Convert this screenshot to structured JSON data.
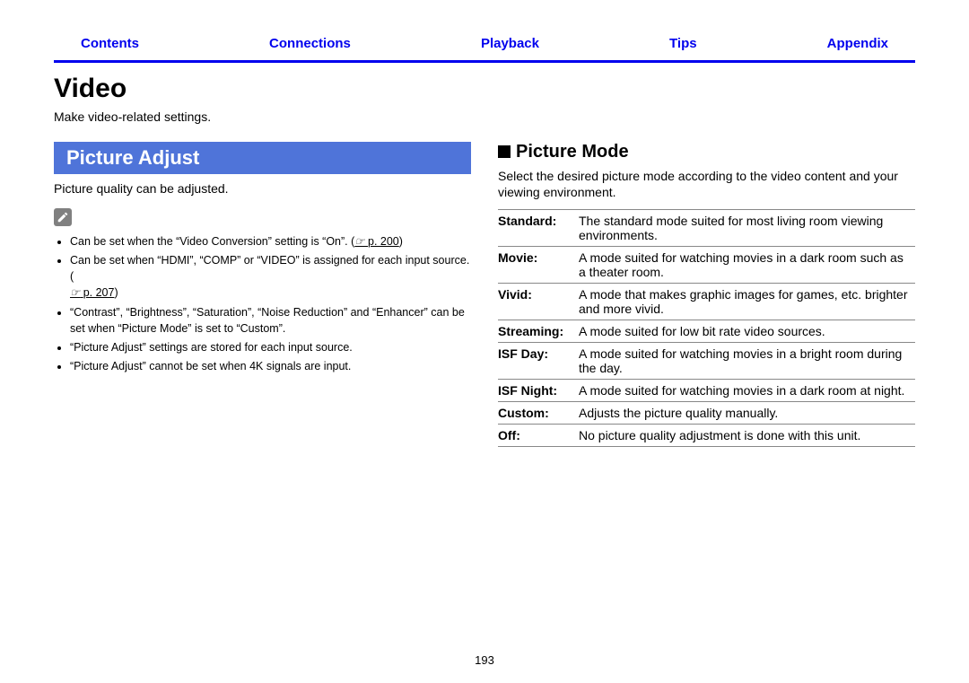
{
  "nav": {
    "contents": "Contents",
    "connections": "Connections",
    "playback": "Playback",
    "tips": "Tips",
    "appendix": "Appendix"
  },
  "title": "Video",
  "subtitle": "Make video-related settings.",
  "left": {
    "bar": "Picture Adjust",
    "lead": "Picture quality can be adjusted.",
    "page200_label": "p. 200",
    "page207_label": "p. 207",
    "note1a": "Can be set when the “Video Conversion” setting is “On”.  (",
    "note1b": ")",
    "note2a": "Can be set when “HDMI”, “COMP” or “VIDEO” is assigned for each input source. (",
    "note2b": ")",
    "note3": "“Contrast”, “Brightness”, “Saturation”, “Noise Reduction” and “Enhancer” can be set when “Picture Mode” is set to “Custom”.",
    "note4": "“Picture Adjust” settings are stored for each input source.",
    "note5": "“Picture Adjust” cannot be set when 4K signals are input."
  },
  "right": {
    "heading": "Picture Mode",
    "intro": "Select the desired picture mode according to the video content and your viewing environment.",
    "rows": [
      {
        "label": "Standard:",
        "desc": "The standard mode suited for most living room viewing environments."
      },
      {
        "label": "Movie:",
        "desc": "A mode suited for watching movies in a dark room such as a theater room."
      },
      {
        "label": "Vivid:",
        "desc": "A mode that makes graphic images for games, etc. brighter and more vivid."
      },
      {
        "label": "Streaming:",
        "desc": "A mode suited for low bit rate video sources."
      },
      {
        "label": "ISF Day:",
        "desc": "A mode suited for watching movies in a bright room during the day."
      },
      {
        "label": "ISF Night:",
        "desc": "A mode suited for watching movies in a dark room at night."
      },
      {
        "label": "Custom:",
        "desc": "Adjusts the picture quality manually."
      },
      {
        "label": "Off:",
        "desc": "No picture quality adjustment is done with this unit."
      }
    ]
  },
  "page_number": "193"
}
